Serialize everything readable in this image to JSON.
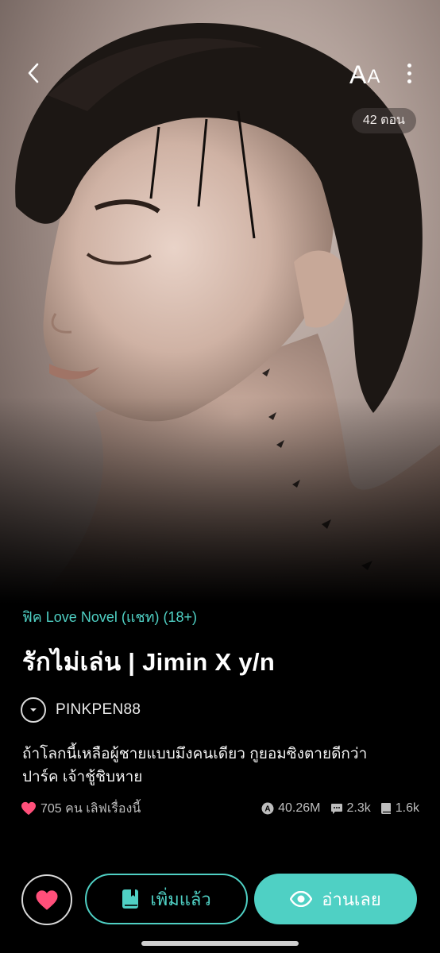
{
  "header": {
    "back_icon": "chevron-left-icon",
    "font_size_large": "A",
    "font_size_small": "A",
    "more_icon": "more-vertical-icon",
    "episodes": "42 ตอน"
  },
  "cover": {
    "image_icon": "cover-image"
  },
  "story": {
    "genre": "ฟิค Love Novel (แชท) (18+)",
    "title": "รักไม่เล่น | Jimin X y/n",
    "author": "PINKPEN88",
    "synopsis_line1": "ถ้าโลกนี้เหลือผู้ชายแบบมึงคนเดียว กูยอมซิงตายดีกว่า",
    "synopsis_line2": "ปาร์ค เจ้าชู้ชิบหาย"
  },
  "stats": {
    "likes": "705 คน เลิฟเรื่องนี้",
    "reads": "40.26M",
    "comments": "2.3k",
    "library_adds": "1.6k"
  },
  "actions": {
    "library_label": "เพิ่มแล้ว",
    "read_label": "อ่านเลย"
  },
  "colors": {
    "accent": "#4fd0c4",
    "heart": "#ff4f7a",
    "background": "#000000"
  }
}
